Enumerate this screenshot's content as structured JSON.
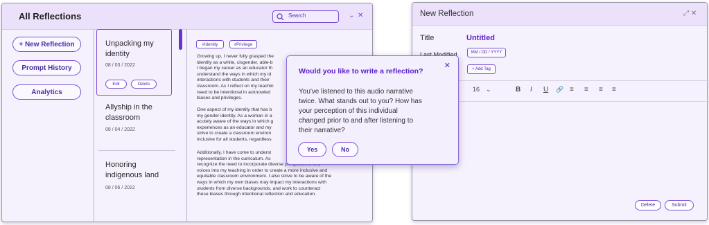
{
  "left_window": {
    "title": "All Reflections",
    "search_placeholder": "Search",
    "nav": [
      "+ New Reflection",
      "Prompt History",
      "Analytics"
    ],
    "items": [
      {
        "title_l1": "Unpacking my",
        "title_l2": "identity",
        "date": "08 / 03 / 2022"
      },
      {
        "title_l1": "Allyship in the",
        "title_l2": "classroom",
        "date": "08 / 04 / 2022"
      },
      {
        "title_l1": "Honoring",
        "title_l2": "indigenous land",
        "date": "08 / 06 / 2022"
      }
    ],
    "edit_label": "Edit",
    "delete_label": "Delete",
    "tags": [
      "#Identity",
      "#Privilege"
    ],
    "paragraphs": [
      [
        "Growing up, I never fully grasped the",
        "identity as a white, cisgender, able-b",
        "I began my career as an educator th",
        "understand the ways in which my id",
        "interactions with students and their",
        "classroom. As I reflect on my teachin",
        "need to be intentional in acknowled",
        "biases and privileges."
      ],
      [
        "One aspect of my identity that has b",
        "my gender identity. As a woman in a",
        "acutely aware of the ways in which g",
        "experiences as an educator and my",
        "strive to create a classroom environ",
        "inclusive for all students, regardless"
      ],
      [
        "Additionally, I have come to underst",
        "representation in the curriculum. As",
        "recognize the need to incorporate diverse perspectives and",
        "voices into my teaching in order to create a more inclusive and",
        "equitable classroom environment. I also strive to be aware of the",
        "ways in which my own biases may impact my interactions with",
        "students from diverse backgrounds, and work to counteract",
        "these biases through intentional reflection and education."
      ]
    ]
  },
  "modal": {
    "question": "Would you like to write a reflection?",
    "body_lines": [
      "You've listened to this audio narrative",
      "twice. What stands out to you? How has",
      "your perception of this individual",
      "changed prior to and after listening to",
      "their narrative?"
    ],
    "yes": "Yes",
    "no": "No"
  },
  "right_window": {
    "title": "New Reflection",
    "title_label": "Title",
    "title_value": "Untitled",
    "last_modified_label": "Last Modified",
    "date_placeholder": "MM / DD / YYYY",
    "add_tag": "+ Add Tag",
    "font_size": "16",
    "delete": "Delete",
    "submit": "Submit"
  }
}
